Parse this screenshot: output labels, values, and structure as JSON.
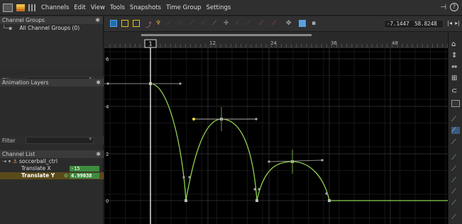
{
  "menu": {
    "items": [
      "Channels",
      "Edit",
      "View",
      "Tools",
      "Snapshots",
      "Time Group",
      "Settings"
    ]
  },
  "panels": {
    "channel_groups": {
      "title": "Channel Groups",
      "group_label": "All Channel Groups (0)"
    },
    "filter_label": "Filter",
    "animation_layers": {
      "title": "Animation Layers"
    },
    "channel_list": {
      "title": "Channel List",
      "object": "soccerball_ctrl",
      "channels": [
        {
          "name": "Translate X",
          "value": "-15"
        },
        {
          "name": "Translate Y",
          "value": "4.99038"
        }
      ]
    }
  },
  "toolbar": {
    "coord_x": "-7.1447",
    "coord_y": "58.8248"
  },
  "graph": {
    "frame_ticks": [
      "1",
      "12",
      "24",
      "36",
      "48"
    ],
    "value_ticks": [
      "6",
      "4",
      "2",
      "0"
    ],
    "current_frame": "1",
    "curve_color": "#8fd14f",
    "selected_key_color": "#f0e040"
  }
}
